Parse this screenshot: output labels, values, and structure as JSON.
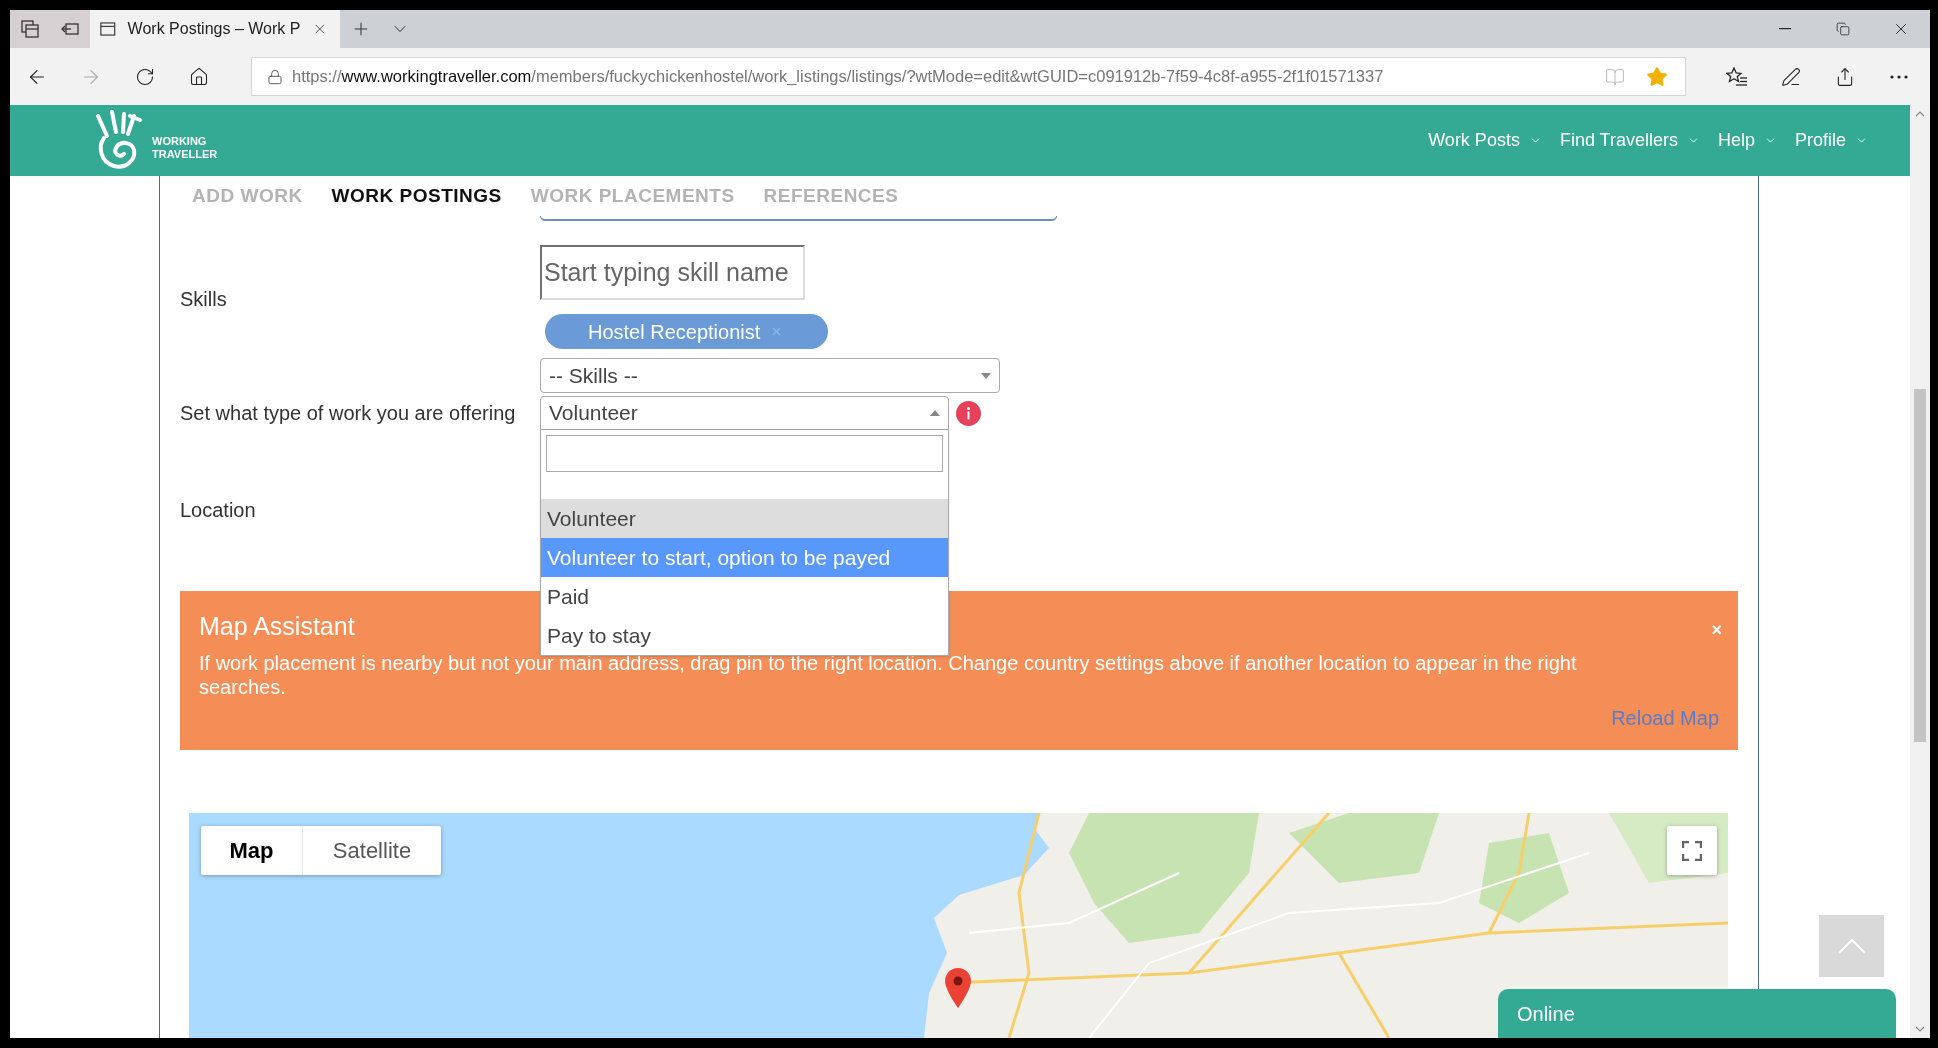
{
  "browser": {
    "tab": {
      "title": "Work Postings – Work P"
    },
    "url": {
      "scheme": "https://",
      "host": "www.workingtraveller.com",
      "path": "/members/fuckychickenhostel/work_listings/listings/?wtMode=edit&wtGUID=c091912b-7f59-4c8f-a955-2f1f01571337"
    },
    "favorite": true
  },
  "header": {
    "logo": {
      "lines": [
        "WORKING",
        "TRAVELLER"
      ]
    },
    "nav": [
      {
        "label": "Work Posts"
      },
      {
        "label": "Find Travellers"
      },
      {
        "label": "Help"
      },
      {
        "label": "Profile"
      }
    ]
  },
  "section_tabs": [
    {
      "label": "ADD WORK",
      "selected": false
    },
    {
      "label": "WORK POSTINGS",
      "selected": true
    },
    {
      "label": "WORK PLACEMENTS",
      "selected": false
    },
    {
      "label": "REFERENCES",
      "selected": false
    }
  ],
  "form": {
    "skills": {
      "label": "Skills",
      "placeholder": "Start typing skill name",
      "tags": [
        {
          "label": "Hostel Receptionist"
        }
      ],
      "select": {
        "value": "-- Skills --"
      }
    },
    "work_type": {
      "label": "Set what type of work you are offering",
      "value": "Volunteer",
      "open": true,
      "options": [
        {
          "label": "Volunteer",
          "selected": true,
          "highlighted": false
        },
        {
          "label": "Volunteer to start, option to be payed",
          "selected": false,
          "highlighted": true
        },
        {
          "label": "Paid",
          "selected": false,
          "highlighted": false
        },
        {
          "label": "Pay to stay",
          "selected": false,
          "highlighted": false
        }
      ]
    },
    "location": {
      "label": "Location"
    }
  },
  "map_assistant": {
    "title": "Map Assistant",
    "text": "If work placement is nearby but not your main address, drag pin to the right location. Change country settings above if another location to appear in the right searches.",
    "close": "×",
    "link": "Reload Map"
  },
  "map": {
    "view_buttons": [
      {
        "label": "Map",
        "selected": true
      },
      {
        "label": "Satellite",
        "selected": false
      }
    ]
  },
  "chat": {
    "label": "Online"
  }
}
